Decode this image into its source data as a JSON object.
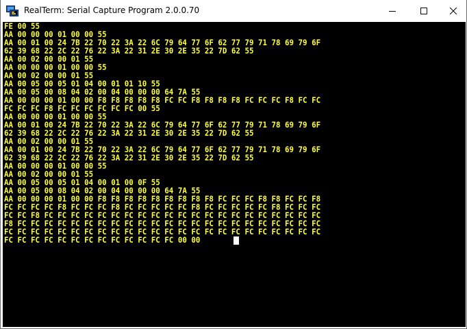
{
  "window": {
    "title": "RealTerm: Serial Capture Program 2.0.0.70",
    "icon": "realterm-app-icon",
    "controls": [
      "minimize-icon",
      "maximize-icon",
      "close-icon"
    ]
  },
  "terminal": {
    "background": "#000000",
    "text_color": "#ffff3c",
    "lines": [
      "FE 00 55",
      "AA 00 00 00 01 00 00 55",
      "AA 00 01 00 24 7B 22 70 22 3A 22 6C 79 64 77 6F 62 77 79 71 78 69 79 6F",
      "62 39 68 22 2C 22 76 22 3A 22 31 2E 30 2E 35 22 7D 62 55",
      "AA 00 02 00 00 01 55",
      "AA 00 00 00 01 00 00 55",
      "AA 00 02 00 00 01 55",
      "AA 00 05 00 05 01 04 00 01 01 10 55",
      "AA 00 05 00 08 04 02 00 04 00 00 00 64 7A 55",
      "AA 00 00 00 01 00 00 F8 F8 F8 F8 F8 FC FC F8 F8 F8 F8 FC FC FC F8 FC FC",
      "FC FC FC F8 FC FC FC FC FC FC 00 55",
      "AA 00 00 00 01 00 00 55",
      "AA 00 01 00 24 7B 22 70 22 3A 22 6C 79 64 77 6F 62 77 79 71 78 69 79 6F",
      "62 39 68 22 2C 22 76 22 3A 22 31 2E 30 2E 35 22 7D 62 55",
      "AA 00 02 00 00 01 55",
      "AA 00 01 00 24 7B 22 70 22 3A 22 6C 79 64 77 6F 62 77 79 71 78 69 79 6F",
      "62 39 68 22 2C 22 76 22 3A 22 31 2E 30 2E 35 22 7D 62 55",
      "AA 00 00 00 01 00 00 55",
      "AA 00 02 00 00 01 55",
      "AA 00 05 00 05 01 04 00 01 00 0F 55",
      "AA 00 05 00 08 04 02 00 04 00 00 00 64 7A 55",
      "AA 00 00 00 01 00 00 F8 F8 F8 F8 F8 F8 F8 F8 F8 FC FC FC F8 F8 FC FC F8",
      "FC FC FC FC F8 FC FC FC F8 FC FC FC FC FC F8 FC FC FC FC FC F8 FC FC FC",
      "FC FC F8 FC FC FC FC FC FC FC FC FC FC FC FC FC FC FC FC FC FC FC FC FC",
      "F8 FC FC FC FC FC FC FC FC FC FC FC FC FC FC FC FC FC FC FC FC FC FC FC",
      "FC FC FC FC FC FC FC FC FC FC FC FC FC FC FC FC FC FC FC FC FC FC FC FC",
      "FC FC FC FC FC FC FC FC FC FC FC FC FC 00 00"
    ]
  }
}
